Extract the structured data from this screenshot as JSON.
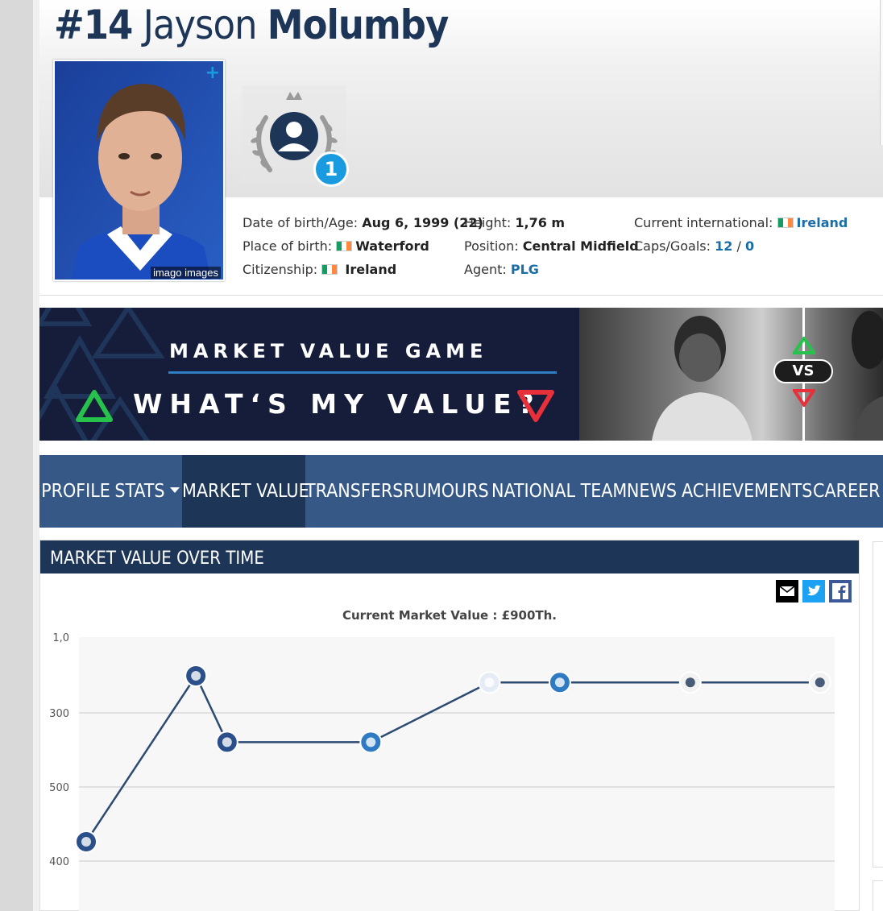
{
  "player": {
    "number": "#14",
    "first_name": "Jayson",
    "last_name": "Molumby",
    "photo_credit": "imago images",
    "award_count": "1"
  },
  "info": {
    "dob_label": "Date of birth/Age:",
    "dob_value": "Aug 6, 1999 (22)",
    "pob_label": "Place of birth:",
    "pob_value": "Waterford",
    "citizenship_label": "Citizenship:",
    "citizenship_value": "Ireland",
    "height_label": "Height:",
    "height_value": "1,76 m",
    "position_label": "Position:",
    "position_value": "Central Midfield",
    "agent_label": "Agent:",
    "agent_value": "PLG",
    "intl_label": "Current international:",
    "intl_value": "Ireland",
    "caps_label": "Caps/Goals:",
    "caps_value": "12",
    "caps_sep": "/",
    "goals_value": "0"
  },
  "banner": {
    "title": "MARKET VALUE GAME",
    "subtitle": "WHAT‘S MY VALUE?",
    "vs": "VS"
  },
  "nav": {
    "items": [
      "PROFILE",
      "STATS",
      "MARKET VALUE",
      "TRANSFERS",
      "RUMOURS",
      "NATIONAL TEAM",
      "NEWS",
      "ACHIEVEMENTS",
      "CAREER"
    ],
    "active": "MARKET VALUE"
  },
  "market_value": {
    "header": "MARKET VALUE OVER TIME",
    "current_label": "Current Market Value : £900Th."
  },
  "chart_data": {
    "type": "line",
    "title": "Current Market Value : £900Th.",
    "y_tick_labels": [
      "1,0",
      "300",
      "500",
      "400"
    ],
    "series": [
      {
        "y_index": [
          0.0,
          1.0,
          0.6,
          0.6,
          0.6,
          0.96,
          0.96,
          0.96,
          0.96
        ],
        "x_index": [
          0.0,
          0.148,
          0.19,
          0.384,
          0.384,
          0.544,
          0.639,
          0.815,
          0.99
        ]
      }
    ],
    "grid": true,
    "legend": "none"
  },
  "colors": {
    "navy": "#1d3557",
    "nav_blue": "#355887",
    "accent_blue": "#1a9be0",
    "line": "#2c4a72"
  }
}
